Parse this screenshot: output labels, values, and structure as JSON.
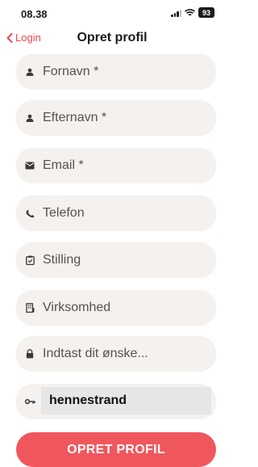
{
  "status": {
    "time": "08.38",
    "battery": "93"
  },
  "nav": {
    "back_label": "Login",
    "title": "Opret profil"
  },
  "fields": [
    {
      "name": "first-name-field",
      "icon": "person-icon",
      "placeholder": "Fornavn *"
    },
    {
      "name": "last-name-field",
      "icon": "person-icon",
      "placeholder": "Efternavn *"
    },
    {
      "name": "email-field",
      "icon": "envelope-icon",
      "placeholder": "Email *"
    },
    {
      "name": "phone-field",
      "icon": "phone-icon",
      "placeholder": "Telefon"
    },
    {
      "name": "job-title-field",
      "icon": "clipboard-check-icon",
      "placeholder": "Stilling"
    },
    {
      "name": "company-field",
      "icon": "building-icon",
      "placeholder": "Virksomhed"
    },
    {
      "name": "desired-password-field",
      "icon": "lock-icon",
      "placeholder": "Indtast dit ønske..."
    }
  ],
  "password_field": {
    "icon": "key-icon",
    "value": "hennestrand"
  },
  "submit": {
    "label": "OPRET PROFIL"
  },
  "colors": {
    "accent": "#e8484f",
    "button": "#f0575d",
    "field_bg": "#f4f1ef"
  }
}
